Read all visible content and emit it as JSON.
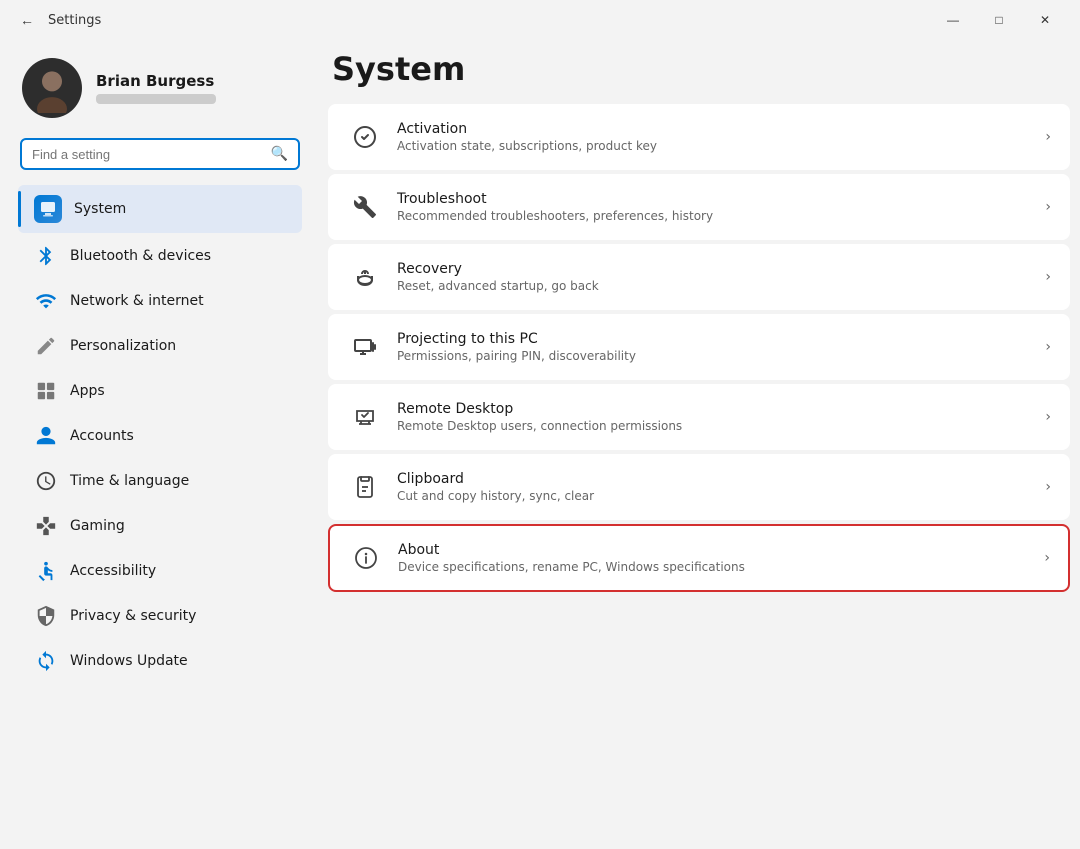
{
  "titlebar": {
    "title": "Settings",
    "back_label": "←",
    "minimize_label": "—",
    "maximize_label": "□",
    "close_label": "✕"
  },
  "sidebar": {
    "search_placeholder": "Find a setting",
    "user": {
      "name": "Brian Burgess"
    },
    "nav_items": [
      {
        "id": "system",
        "label": "System",
        "icon": "🖥",
        "active": true
      },
      {
        "id": "bluetooth",
        "label": "Bluetooth & devices",
        "icon": "🔵",
        "active": false
      },
      {
        "id": "network",
        "label": "Network & internet",
        "icon": "🌐",
        "active": false
      },
      {
        "id": "personalization",
        "label": "Personalization",
        "icon": "✏️",
        "active": false
      },
      {
        "id": "apps",
        "label": "Apps",
        "icon": "📦",
        "active": false
      },
      {
        "id": "accounts",
        "label": "Accounts",
        "icon": "👤",
        "active": false
      },
      {
        "id": "time",
        "label": "Time & language",
        "icon": "🕐",
        "active": false
      },
      {
        "id": "gaming",
        "label": "Gaming",
        "icon": "🎮",
        "active": false
      },
      {
        "id": "accessibility",
        "label": "Accessibility",
        "icon": "♿",
        "active": false
      },
      {
        "id": "privacy",
        "label": "Privacy & security",
        "icon": "🛡",
        "active": false
      },
      {
        "id": "windows-update",
        "label": "Windows Update",
        "icon": "🔄",
        "active": false
      }
    ]
  },
  "main": {
    "page_title": "System",
    "settings_items": [
      {
        "id": "activation",
        "title": "Activation",
        "desc": "Activation state, subscriptions, product key",
        "icon": "activation"
      },
      {
        "id": "troubleshoot",
        "title": "Troubleshoot",
        "desc": "Recommended troubleshooters, preferences, history",
        "icon": "troubleshoot"
      },
      {
        "id": "recovery",
        "title": "Recovery",
        "desc": "Reset, advanced startup, go back",
        "icon": "recovery"
      },
      {
        "id": "projecting",
        "title": "Projecting to this PC",
        "desc": "Permissions, pairing PIN, discoverability",
        "icon": "projecting"
      },
      {
        "id": "remote-desktop",
        "title": "Remote Desktop",
        "desc": "Remote Desktop users, connection permissions",
        "icon": "remote"
      },
      {
        "id": "clipboard",
        "title": "Clipboard",
        "desc": "Cut and copy history, sync, clear",
        "icon": "clipboard"
      },
      {
        "id": "about",
        "title": "About",
        "desc": "Device specifications, rename PC, Windows specifications",
        "icon": "about",
        "highlighted": true
      }
    ]
  }
}
